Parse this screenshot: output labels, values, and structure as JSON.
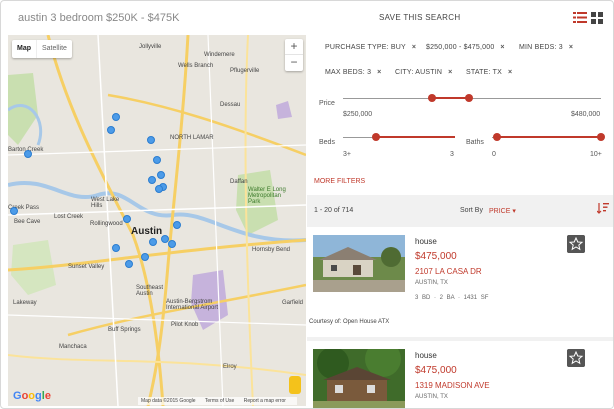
{
  "header": {
    "search_title": "austin 3 bedroom $250K - $475K",
    "save_search_label": "SAVE THIS SEARCH"
  },
  "map": {
    "type_map": "Map",
    "type_satellite": "Satellite",
    "zoom_in": "+",
    "zoom_out": "−",
    "cities": [
      "Jollyville",
      "Windemere",
      "Wells Branch",
      "Pflugerville",
      "Dessau",
      "NORTH LAMAR",
      "Daffan",
      "Walter E Long Metropolitan Park",
      "Austin",
      "West Lake Hills",
      "Lost Creek",
      "Rollingwood",
      "Sunset Valley",
      "Southeast Austin",
      "Austin-Bergstrom International Airport",
      "Hornsby Bend",
      "Garfield",
      "Pilot Knob",
      "Buff Springs",
      "Manchaca",
      "Elroy",
      "Bee Cave",
      "Creek Pass",
      "Lakeway",
      "Barton Creek"
    ],
    "attribution": [
      "Map data ©2015 Google",
      "Terms of Use",
      "Report a map error"
    ],
    "google_logo": [
      "G",
      "o",
      "o",
      "g",
      "l",
      "e"
    ]
  },
  "filters": {
    "chips": [
      {
        "label": "PURCHASE TYPE: BUY"
      },
      {
        "label": "$250,000 - $475,000"
      },
      {
        "label": "MIN BEDS: 3"
      },
      {
        "label": "MAX BEDS: 3"
      },
      {
        "label": "CITY: AUSTIN"
      },
      {
        "label": "STATE: TX"
      }
    ],
    "remove_glyph": "×",
    "price_label": "Price",
    "price_min": "$250,000",
    "price_max": "$480,000",
    "beds_label": "Beds",
    "beds_min": "3+",
    "beds_max": "3",
    "baths_label": "Baths",
    "baths_min": "0",
    "baths_max": "10+",
    "more_filters": "MORE FILTERS"
  },
  "results": {
    "count": "1 - 20 of 714",
    "sort_by_label": "Sort By",
    "sort_value": "PRICE",
    "listings": [
      {
        "type": "house",
        "price": "$475,000",
        "address": "2107 LA CASA DR",
        "city": "AUSTIN, TX",
        "specs": "3 BD · 2 BA · 1431 SF",
        "courtesy": "Courtesy of: Open House ATX"
      },
      {
        "type": "house",
        "price": "$475,000",
        "address": "1319 MADISON AVE",
        "city": "AUSTIN, TX"
      }
    ]
  },
  "colors": {
    "accent": "#c0392b",
    "pin": "#4c9be8",
    "map_bg": "#e9e6df"
  }
}
